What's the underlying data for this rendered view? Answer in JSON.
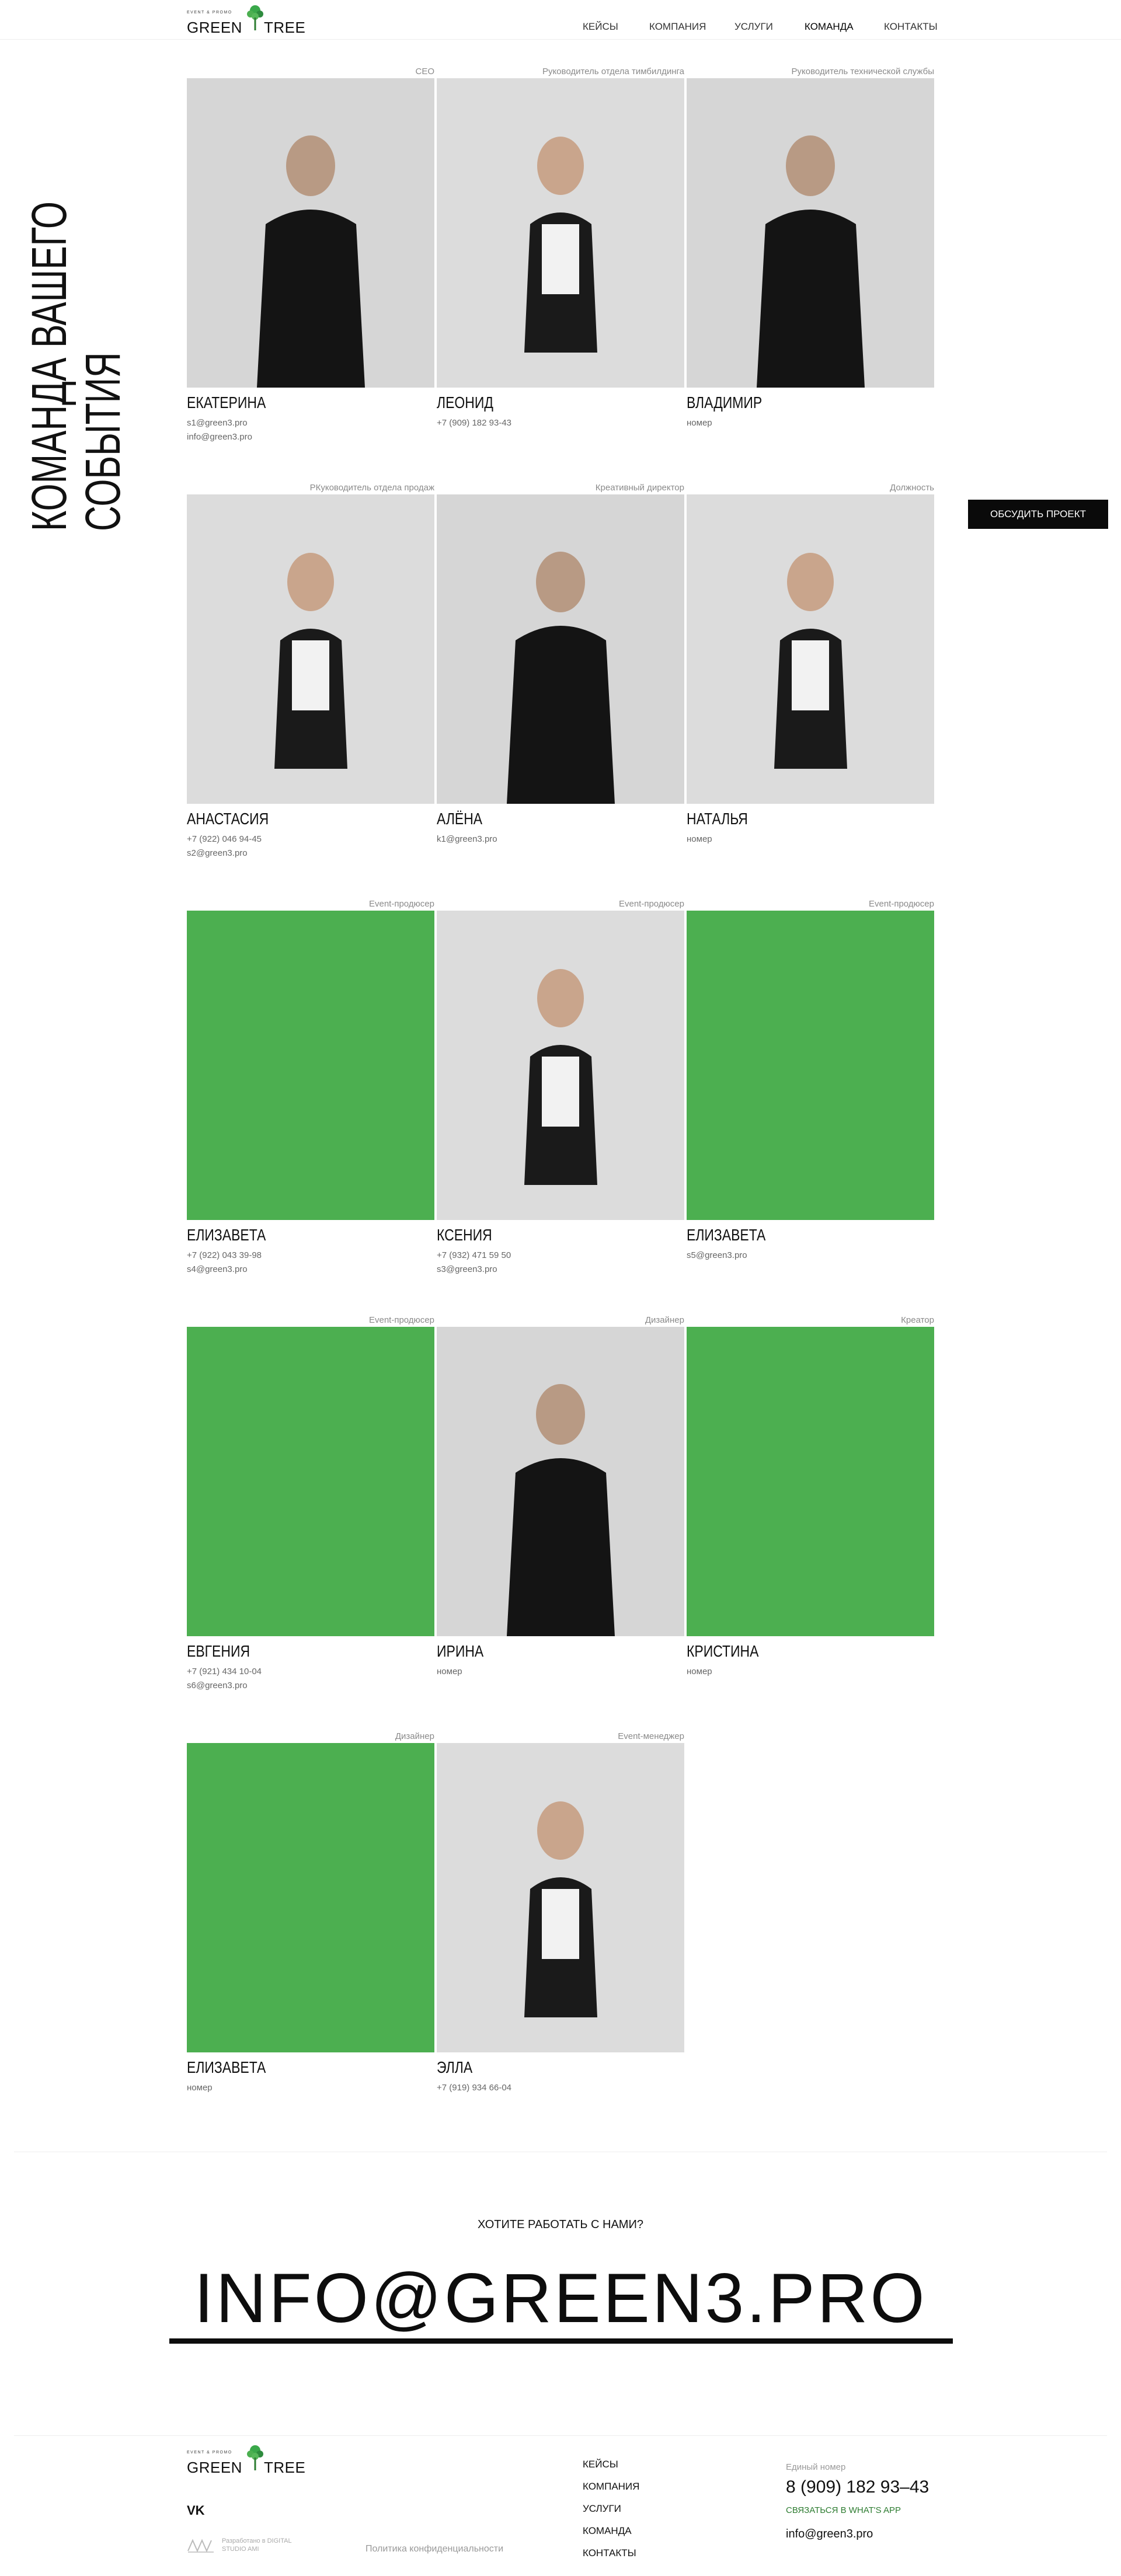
{
  "brand": {
    "tagline": "EVENT & PROMO",
    "word1": "GREEN",
    "word2": "TREE",
    "accent": "#4caf50"
  },
  "nav": {
    "cases": "КЕЙСЫ",
    "company": "КОМПАНИЯ",
    "services": "УСЛУГИ",
    "team": "КОМАНДА",
    "contacts": "КОНТАКТЫ"
  },
  "page": {
    "title_line1": "КОМАНДА ВАШЕГО",
    "title_line2": "СОБЫТИЯ",
    "cta": "ОБСУДИТЬ ПРОЕКТ"
  },
  "team": [
    {
      "role": "CEO",
      "name": "ЕКАТЕРИНА",
      "line1": "s1@green3.pro",
      "line2": "info@green3.pro",
      "photo": "photo"
    },
    {
      "role": "Руководитель отдела тимбилдинга",
      "name": "ЛЕОНИД",
      "line1": "+7 (909) 182 93-43",
      "line2": "",
      "photo": "photo"
    },
    {
      "role": "Руководитель технической службы",
      "name": "ВЛАДИМИР",
      "line1": "номер",
      "line2": "",
      "photo": "photo"
    },
    {
      "role": "РКуководитель отдела продаж",
      "name": "АНАСТАСИЯ",
      "line1": "+7 (922) 046 94-45",
      "line2": "s2@green3.pro",
      "photo": "photo"
    },
    {
      "role": "Креативный директор",
      "name": "АЛЁНА",
      "line1": "k1@green3.pro",
      "line2": "",
      "photo": "photo"
    },
    {
      "role": "Должность",
      "name": "НАТАЛЬЯ",
      "line1": "номер",
      "line2": "",
      "photo": "photo"
    },
    {
      "role": "Event-продюсер",
      "name": "ЕЛИЗАВЕТА",
      "line1": "+7 (922) 043 39-98",
      "line2": "s4@green3.pro",
      "photo": "green"
    },
    {
      "role": "Event-продюсер",
      "name": "КСЕНИЯ",
      "line1": "+7 (932) 471 59 50",
      "line2": "s3@green3.pro",
      "photo": "photo"
    },
    {
      "role": "Event-продюсер",
      "name": "ЕЛИЗАВЕТА",
      "line1": "s5@green3.pro",
      "line2": "",
      "photo": "green"
    },
    {
      "role": "Event-продюсер",
      "name": "ЕВГЕНИЯ",
      "line1": "+7 (921) 434 10-04",
      "line2": "s6@green3.pro",
      "photo": "green"
    },
    {
      "role": "Дизайнер",
      "name": "ИРИНА",
      "line1": "номер",
      "line2": "",
      "photo": "photo"
    },
    {
      "role": "Креатор",
      "name": "КРИСТИНА",
      "line1": "номер",
      "line2": "",
      "photo": "green"
    },
    {
      "role": "Дизайнер",
      "name": "ЕЛИЗАВЕТА",
      "line1": "номер",
      "line2": "",
      "photo": "green"
    },
    {
      "role": "Event-менеджер",
      "name": "ЭЛЛА",
      "line1": "+7 (919) 934 66-04",
      "line2": "",
      "photo": "photo"
    }
  ],
  "contact": {
    "question": "ХОТИТЕ РАБОТАТЬ С НАМИ?",
    "email": "INFO@GREEN3.PRO"
  },
  "footer": {
    "vk": "VK",
    "studio": "Разработано в DIGITAL STUDIO AMI",
    "privacy": "Политика конфиденциальности",
    "nav": [
      "КЕЙСЫ",
      "КОМПАНИЯ",
      "УСЛУГИ",
      "КОМАНДА",
      "КОНТАКТЫ"
    ],
    "phone_label": "Единый номер",
    "phone": "8 (909) 182 93–43",
    "whatsapp": "СВЯЗАТЬСЯ В WHAT'S APP",
    "email": "info@green3.pro"
  }
}
